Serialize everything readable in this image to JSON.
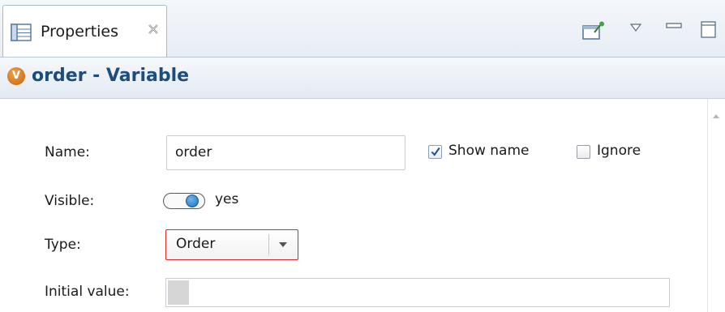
{
  "view": {
    "tab_label": "Properties",
    "icons": {
      "tab": "properties-view-icon",
      "close": "close-icon",
      "pin": "pin-icon",
      "menu": "view-menu-icon",
      "minimize": "minimize-icon",
      "maximize": "maximize-icon"
    }
  },
  "header": {
    "badge_letter": "V",
    "title": "order - Variable",
    "accent_color": "#1e4d7b",
    "badge_color": "#d9721e"
  },
  "form": {
    "name_label": "Name:",
    "name_value": "order",
    "show_name": {
      "label": "Show name",
      "checked": true
    },
    "ignore": {
      "label": "Ignore",
      "checked": false
    },
    "visible_label": "Visible:",
    "visible_value": "yes",
    "type_label": "Type:",
    "type_value": "Order",
    "type_error_color": "#d9262a",
    "initial_value_label": "Initial value:",
    "initial_value": ""
  }
}
